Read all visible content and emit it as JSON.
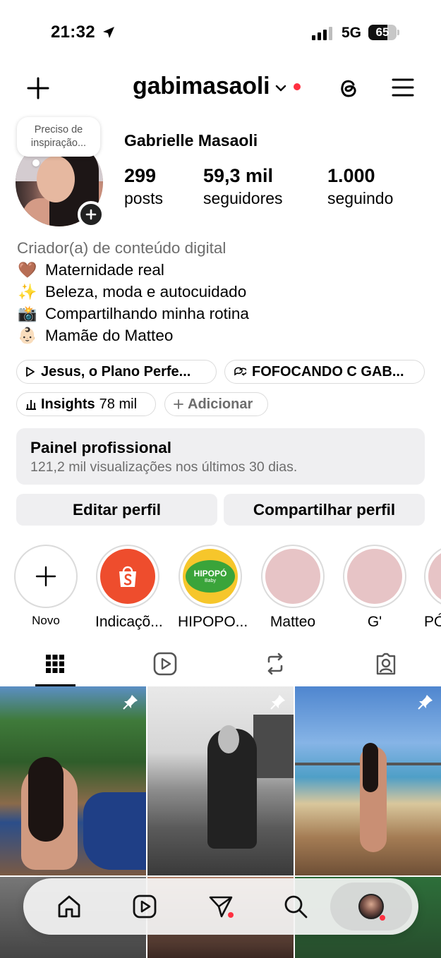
{
  "status_bar": {
    "time": "21:32",
    "network": "5G",
    "battery": "65"
  },
  "header": {
    "username": "gabimasaoli"
  },
  "profile": {
    "note": "Preciso de inspiração...",
    "display_name": "Gabrielle Masaoli",
    "stats": [
      {
        "value": "299",
        "label": "posts"
      },
      {
        "value": "59,3 mil",
        "label": "seguidores"
      },
      {
        "value": "1.000",
        "label": "seguindo"
      }
    ],
    "category": "Criador(a) de conteúdo digital",
    "bio_lines": [
      {
        "emoji": "🤎",
        "text": "Maternidade real"
      },
      {
        "emoji": "✨",
        "text": "Beleza, moda e autocuidado"
      },
      {
        "emoji": "📸",
        "text": "Compartilhando minha rotina"
      },
      {
        "emoji": "👶🏻",
        "text": "Mamãe do Matteo"
      }
    ]
  },
  "pills": {
    "music": "Jesus, o Plano Perfe...",
    "threads": "FOFOCANDO C GAB...",
    "insights_label": "Insights",
    "insights_value": "78 mil",
    "add": "Adicionar"
  },
  "pro_panel": {
    "title": "Painel profissional",
    "subtitle": "121,2 mil visualizações nos últimos 30 dias."
  },
  "buttons": {
    "edit": "Editar perfil",
    "share": "Compartilhar perfil"
  },
  "highlights": [
    {
      "label": "Novo"
    },
    {
      "label": "Indicaçõ..."
    },
    {
      "label": "HIPOPO..."
    },
    {
      "label": "Matteo"
    },
    {
      "label": "G'"
    },
    {
      "label": "PÓ"
    }
  ],
  "hipopo_logo": {
    "main": "HIPOPÓ",
    "sub": "Baby"
  },
  "colors": {
    "accent_red": "#ff3040",
    "panel_bg": "#efeff1",
    "shopee_orange": "#ee4d2d",
    "hipopo_yellow": "#f6c62b",
    "highlight_pink": "#e7c4c6"
  }
}
